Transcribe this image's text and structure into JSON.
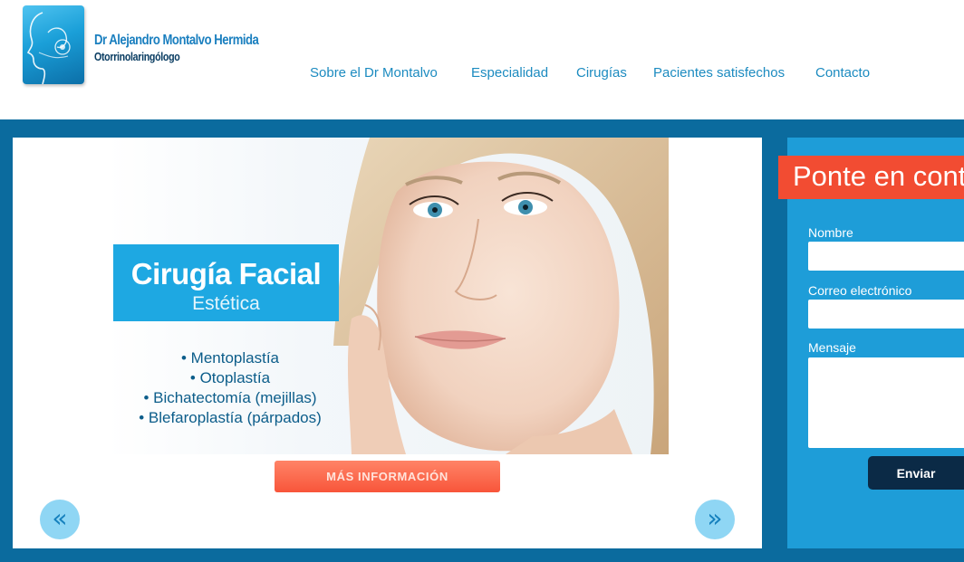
{
  "brand": {
    "name": "Dr Alejandro Montalvo Hermida",
    "subtitle": "Otorrinolaringólogo"
  },
  "nav": {
    "items": [
      {
        "label": "Sobre el Dr Montalvo"
      },
      {
        "label": "Especialidad"
      },
      {
        "label": "Cirugías"
      },
      {
        "label": "Pacientes satisfechos"
      },
      {
        "label": "Contacto"
      }
    ]
  },
  "slide": {
    "title": "Cirugía Facial",
    "subtitle": "Estética",
    "procedures": [
      "• Mentoplastía",
      "• Otoplastía",
      "• Bichatectomía (mejillas)",
      "• Blefaroplastía (párpados)"
    ],
    "more_button": "MÁS INFORMACIÓN",
    "prev_icon": "double-chevron-left-icon",
    "next_icon": "double-chevron-right-icon",
    "prev_glyph": "«",
    "next_glyph": "»"
  },
  "contact": {
    "heading": "Ponte en contacto",
    "name_label": "Nombre",
    "name_value": "",
    "email_label": "Correo electrónico",
    "email_value": "",
    "message_label": "Mensaje",
    "message_value": "",
    "submit_label": "Enviar"
  },
  "colors": {
    "brand_blue": "#1ea8e2",
    "band": "#0b6b9e",
    "accent_orange": "#f24c32",
    "submit_dark": "#0b2a46"
  }
}
